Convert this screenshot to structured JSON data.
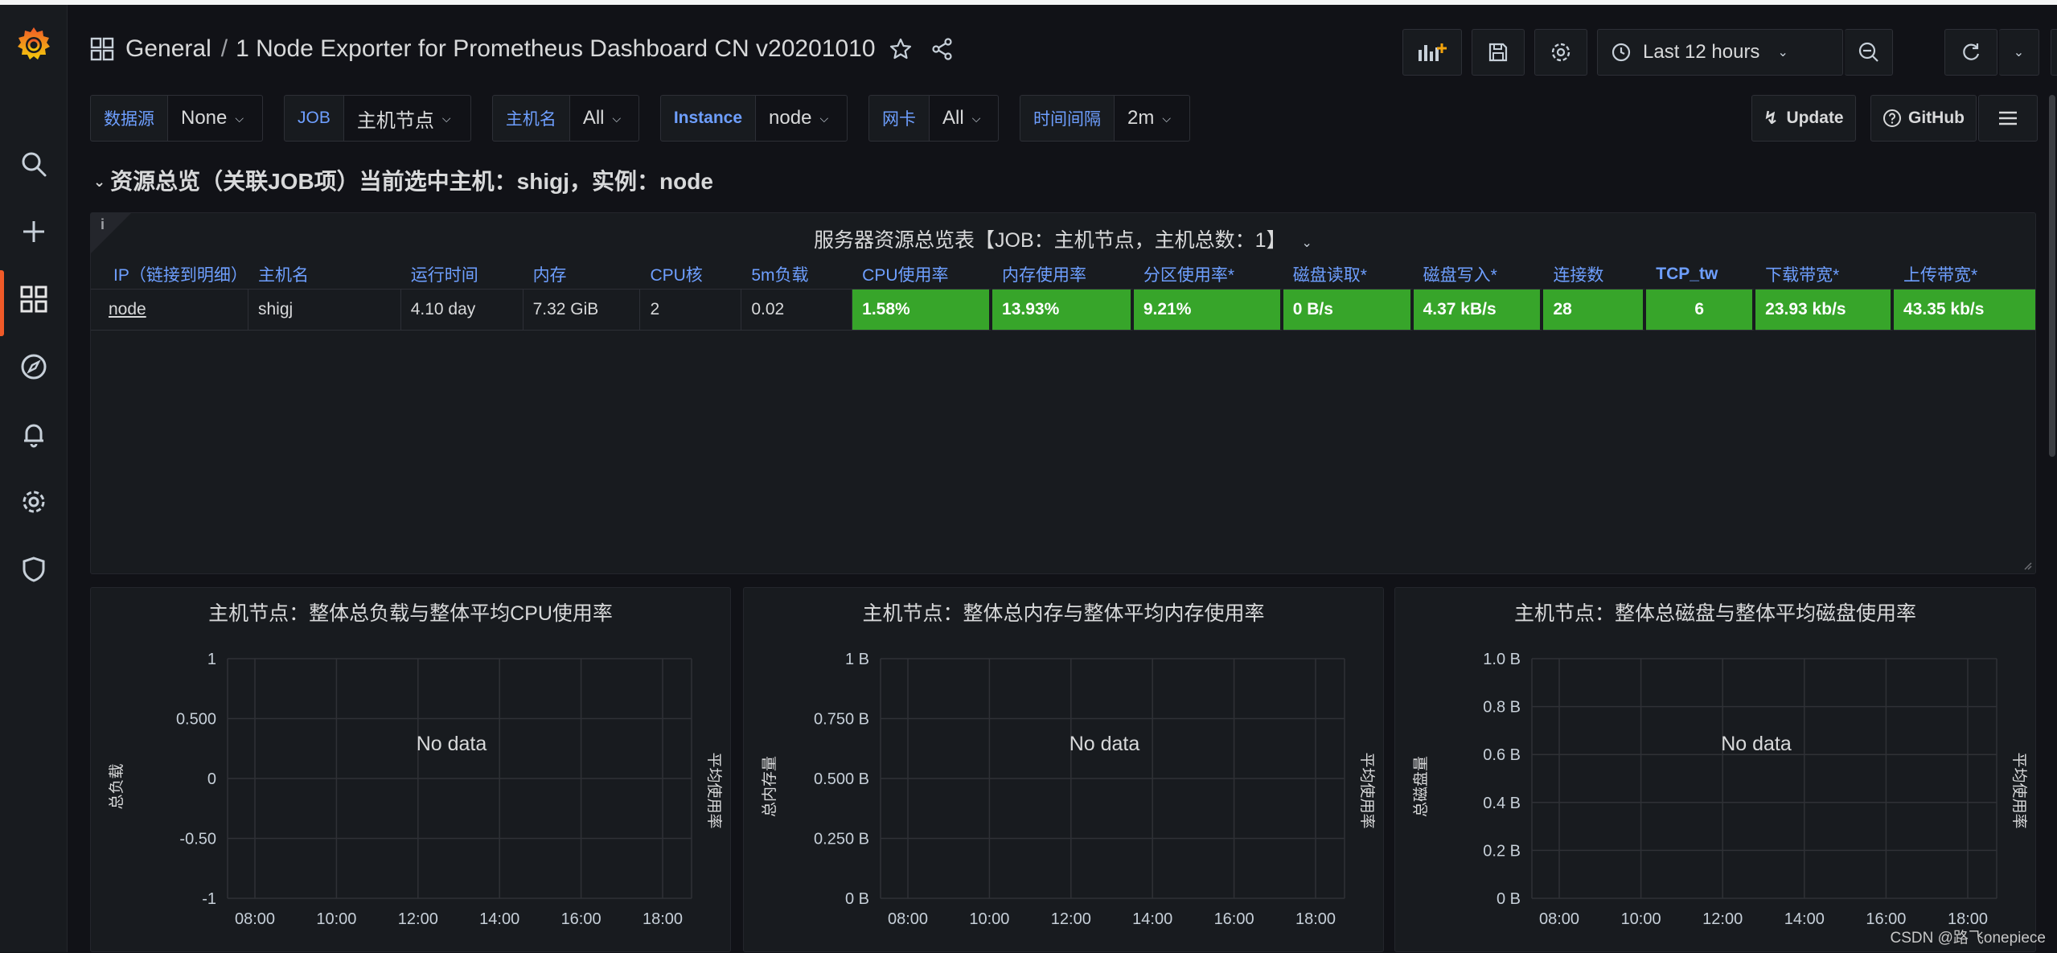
{
  "colors": {
    "accent": "#f05a28",
    "link": "#6e9fff",
    "ok": "#37a52a",
    "bg": "#111217",
    "panel": "#181b1f"
  },
  "header": {
    "breadcrumb_root": "General",
    "breadcrumb_sep": "/",
    "dashboard_title": "1 Node Exporter for Prometheus Dashboard CN v20201010",
    "time_range": "Last 12 hours"
  },
  "variables": [
    {
      "label": "数据源",
      "value": "None"
    },
    {
      "label": "JOB",
      "value": "主机节点"
    },
    {
      "label": "主机名",
      "value": "All"
    },
    {
      "label": "Instance",
      "value": "node"
    },
    {
      "label": "网卡",
      "value": "All"
    },
    {
      "label": "时间间隔",
      "value": "2m"
    }
  ],
  "links": {
    "update": "Update",
    "github": "GitHub"
  },
  "row": {
    "title": "资源总览（关联JOB项）当前选中主机：shigj，实例：node"
  },
  "table_panel": {
    "title": "服务器资源总览表【JOB：主机节点，主机总数：1】",
    "info": "i",
    "columns": [
      "IP（链接到明细）",
      "主机名",
      "运行时间",
      "内存",
      "CPU核",
      "5m负载",
      "CPU使用率",
      "内存使用率",
      "分区使用率*",
      "磁盘读取*",
      "磁盘写入*",
      "连接数",
      "TCP_tw",
      "下载带宽*",
      "上传带宽*"
    ],
    "rows": [
      [
        "node",
        "shigj",
        "4.10 day",
        "7.32 GiB",
        "2",
        "0.02",
        "1.58%",
        "13.93%",
        "9.21%",
        "0 B/s",
        "4.37 kB/s",
        "28",
        "6",
        "23.93 kb/s",
        "43.35 kb/s"
      ]
    ]
  },
  "charts": [
    {
      "title": "主机节点：整体总负载与整体平均CPU使用率",
      "no_data": "No data",
      "left_label": "总负载",
      "right_label": "平均使用率",
      "yticks": [
        "1",
        "0.500",
        "0",
        "-0.50",
        "-1"
      ],
      "xticks": [
        "08:00",
        "10:00",
        "12:00",
        "14:00",
        "16:00",
        "18:00"
      ]
    },
    {
      "title": "主机节点：整体总内存与整体平均内存使用率",
      "no_data": "No data",
      "left_label": "总内存量",
      "right_label": "平均使用率",
      "yticks": [
        "1 B",
        "0.750 B",
        "0.500 B",
        "0.250 B",
        "0 B"
      ],
      "xticks": [
        "08:00",
        "10:00",
        "12:00",
        "14:00",
        "16:00",
        "18:00"
      ]
    },
    {
      "title": "主机节点：整体总磁盘与整体平均磁盘使用率",
      "no_data": "No data",
      "left_label": "总磁盘量",
      "right_label": "平均使用率",
      "yticks": [
        "1.0 B",
        "0.8 B",
        "0.6 B",
        "0.4 B",
        "0.2 B",
        "0 B"
      ],
      "xticks": [
        "08:00",
        "10:00",
        "12:00",
        "14:00",
        "16:00",
        "18:00"
      ]
    }
  ],
  "watermark": "CSDN @路飞onepiece"
}
